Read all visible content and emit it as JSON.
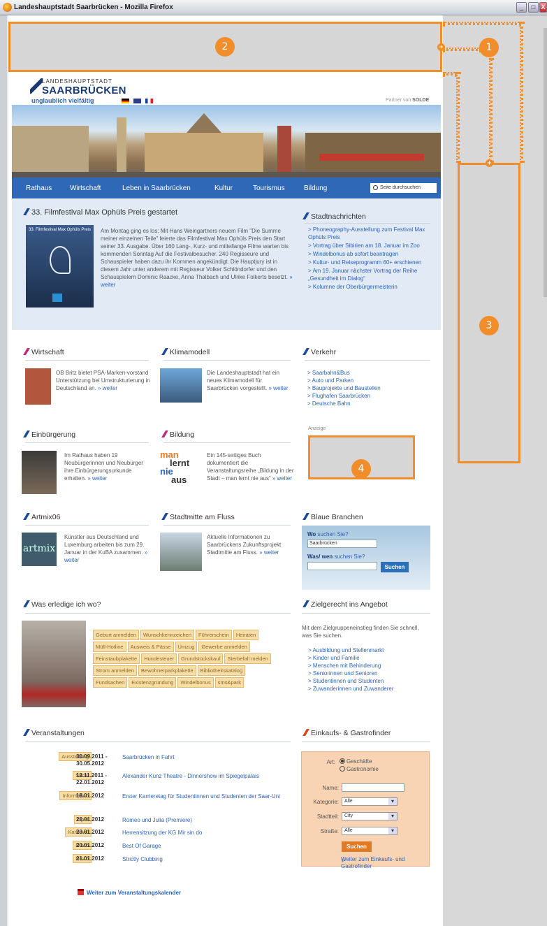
{
  "window": {
    "title": "Landeshauptstadt Saarbrücken - Mozilla Firefox",
    "min_label": "_",
    "max_label": "□",
    "close_label": "X"
  },
  "markers": {
    "m1": "1",
    "m2": "2",
    "m3": "3",
    "m4": "4"
  },
  "header": {
    "logo_line1": "LANDESHAUPTSTADT",
    "logo_line2": "SAARBRÜCKEN",
    "logo_line3": "unglaublich vielfältig",
    "partner_prefix": "Partner von",
    "partner_name": "SOLDE"
  },
  "nav": {
    "items": [
      "Rathaus",
      "Wirtschaft",
      "Leben in Saarbrücken",
      "Kultur",
      "Tourismus",
      "Bildung"
    ],
    "search_placeholder": "Seite durchsuchen"
  },
  "feature": {
    "title": "33. Filmfestival Max Ophüls Preis gestartet",
    "image_caption": "33. Filmfestival Max Ophüls Preis",
    "text": "Am Montag ging es los: Mit Hans Weingartners neuem Film \"Die Summe meiner einzelnen Teile\" feierte das Filmfestival Max Ophüls Preis den Start seiner 33. Ausgabe. Über 160 Lang-, Kurz- und mittellange Filme warten bis kommenden Sonntag Auf die Festivalbesucher. 240 Regisseure und Schauspieler haben dazu ihr Kommen angekündigt. Die Hauptjury ist in diesem Jahr unter anderem mit Regisseur Volker Schlöndorfer und den Schauspielern Dominic Raacke, Anna Thalbach und Ulrike Folkerts besetzt.",
    "more": "» weiter"
  },
  "stadtnachrichten": {
    "title": "Stadtnachrichten",
    "items": [
      "Phoneography-Ausstellung zum Festival Max Ophüls Preis",
      "Vortrag über Sibirien am 18. Januar im Zoo",
      "Windelbonus ab sofort beantragen",
      "Kultur- und Reiseprogramm 60+ erschienen",
      "Am 19. Januar nächster Vortrag der Reihe „Gesundheit im Dialog“",
      "Kolumne der Oberbürgermeisterin"
    ]
  },
  "teasers": {
    "wirtschaft": {
      "title": "Wirtschaft",
      "text": "OB Britz bietet PSA-Marken-vorstand Unterstützung bei Umstrukturierung in Deutschland an.",
      "more": "» weiter"
    },
    "klimamodell": {
      "title": "Klimamodell",
      "text": "Die Landeshauptstadt hat ein neues Klimamodell für Saarbrücken vorgestellt.",
      "more": "» weiter"
    },
    "einbuergerung": {
      "title": "Einbürgerung",
      "text": "Im Rathaus haben 19 Neubürgerinnen und Neubürger ihre Einbürgerungsurkunde erhalten.",
      "more": "» weiter"
    },
    "bildung": {
      "title": "Bildung",
      "text": "Ein 145-seitiges Buch dokumentiert die Veranstaltungsreihe „Bildung in der Stadt – man lernt nie aus“",
      "more": "» weiter",
      "img_line1": "man",
      "img_line2": "lernt",
      "img_line3": "nie",
      "img_line4": "aus"
    },
    "artmix": {
      "title": "Artmix06",
      "text": "Künstler aus Deutschland und Luxemburg arbeiten bis zum 29. Januar in der KuBA zusammen.",
      "more": "» weiter",
      "img_text": "artmix"
    },
    "stadtmitte": {
      "title": "Stadtmitte am Fluss",
      "text": "Aktuelle Informationen zu Saarbrückens Zukunftsprojekt Stadtmitte am Fluss.",
      "more": "» weiter"
    }
  },
  "verkehr": {
    "title": "Verkehr",
    "items": [
      "Saarbahn&Bus",
      "Auto und Parken",
      "Bauprojekte und Baustellen",
      "Flughafen Saarbrücken",
      "Deutsche Bahn"
    ]
  },
  "anzeige": "Anzeige",
  "blaue": {
    "title": "Blaue Branchen",
    "wo_bold": "Wo",
    "wo_rest": "suchen Sie?",
    "wo_value": "Saarbrücken",
    "was_bold": "Was/ wen",
    "was_rest": "suchen Sie?",
    "button": "Suchen"
  },
  "erledige": {
    "title": "Was erledige ich wo?",
    "tags": [
      "Geburt anmelden",
      "Wunschkennzeichen",
      "Führerschein",
      "Heiraten",
      "Müll-Hotline",
      "Ausweis & Pässe",
      "Umzug",
      "Gewerbe anmelden",
      "Feinstaubplakette",
      "Hundesteuer",
      "Grundstückskauf",
      "Sterbefall melden",
      "Strom anmelden",
      "Bewohnerparkplakette",
      "Bibliothekskatalog",
      "Fundsachen",
      "Existenzgründung",
      "Windelbonus",
      "sms&park"
    ]
  },
  "ziel": {
    "title": "Zielgerecht ins Angebot",
    "intro": "Mit dem Zielgruppeneinstieg finden Sie schnell, was Sie suchen.",
    "items": [
      "Ausbildung und Stellenmarkt",
      "Kinder und Familie",
      "Menschen mit Behinderung",
      "Seniorinnen und Senioren",
      "Studentinnen und Studenten",
      "Zuwanderinnen und Zuwanderer"
    ]
  },
  "events": {
    "title": "Veranstaltungen",
    "rows": [
      {
        "cat": "Ausstellung",
        "date": "30.09.2011 - 30.05.2012",
        "title": "Saarbrücken in Fahrt"
      },
      {
        "cat": "Show",
        "date": "12.11.2011 - 22.01.2012",
        "title": "Alexander Kunz Theatre - Dinnershow im Spiegelpalais"
      },
      {
        "cat": "Information",
        "date": "18.01.2012",
        "title": "Erster Karrieretag für Studentinnen und Studenten der Saar-Uni"
      },
      {
        "cat": "Oper",
        "date": "20.01.2012",
        "title": "Romeo und Julia (Premiere)"
      },
      {
        "cat": "Karneval",
        "date": "20.01.2012",
        "title": "Herrensitzung der KG Mir sin do"
      },
      {
        "cat": "Disco",
        "date": "20.01.2012",
        "title": "Best Of Garage"
      },
      {
        "cat": "Disco",
        "date": "21.01.2012",
        "title": "Strictly Clubbing"
      }
    ],
    "calendar": "Weiter zum Veranstaltungskalender"
  },
  "gastro": {
    "title": "Einkaufs- & Gastrofinder",
    "art_label": "Art:",
    "opt1": "Geschäfte",
    "opt2": "Gastronomie",
    "name_label": "Name:",
    "kat_label": "Kategorie:",
    "kat_value": "Alle",
    "stadt_label": "Stadtteil:",
    "stadt_value": "City",
    "str_label": "Straße:",
    "str_value": "Alle",
    "button": "Suchen",
    "more": "Weiter zum Einkaufs- und Gastrofinder"
  },
  "colors": {
    "accent": "#f28d2c",
    "nav": "#2e68b6",
    "link": "#2c62b4"
  }
}
